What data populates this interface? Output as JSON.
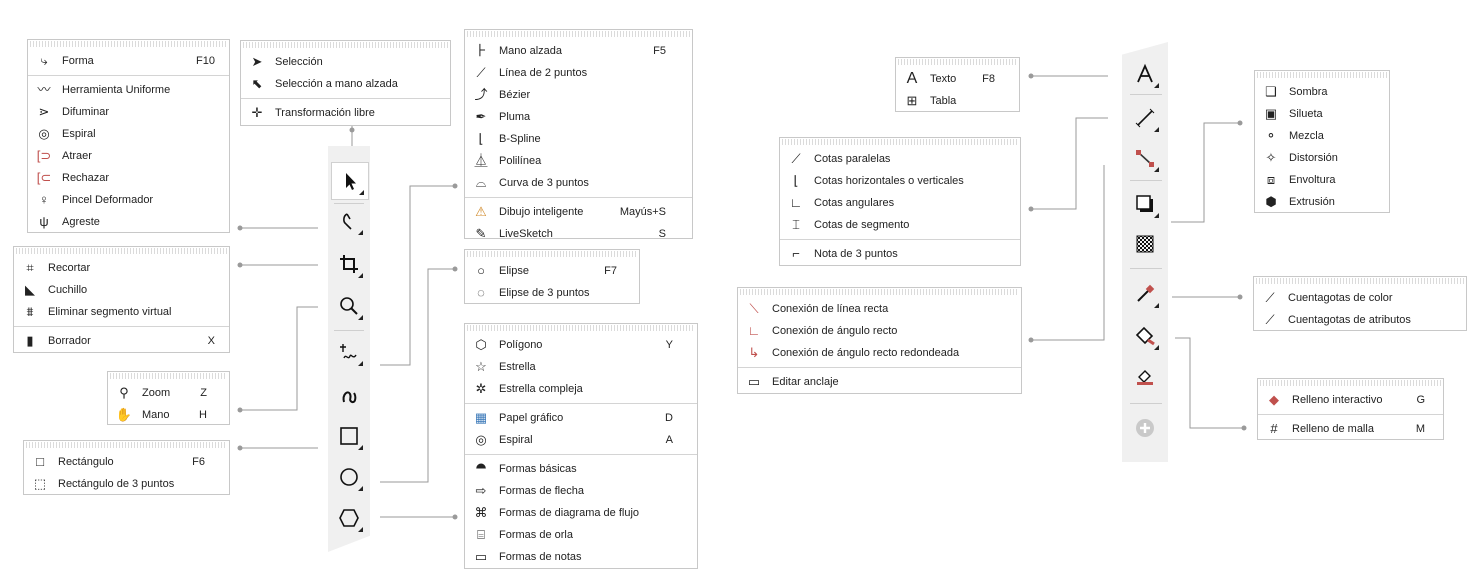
{
  "forma_menu": {
    "items": [
      {
        "label": "Forma",
        "shortcut": "F10",
        "icon": "shape-tool-icon"
      },
      {
        "label": "Herramienta Uniforme",
        "shortcut": "",
        "icon": "smooth-icon"
      },
      {
        "label": "Difuminar",
        "shortcut": "",
        "icon": "smear-icon"
      },
      {
        "label": "Espiral",
        "shortcut": "",
        "icon": "twirl-icon"
      },
      {
        "label": "Atraer",
        "shortcut": "",
        "icon": "attract-icon"
      },
      {
        "label": "Rechazar",
        "shortcut": "",
        "icon": "repel-icon"
      },
      {
        "label": "Pincel Deformador",
        "shortcut": "",
        "icon": "smudge-icon"
      },
      {
        "label": "Agreste",
        "shortcut": "",
        "icon": "roughen-icon"
      }
    ]
  },
  "seleccion_menu": {
    "items": [
      {
        "label": "Selección",
        "icon": "pick-arrow-icon"
      },
      {
        "label": "Selección a mano alzada",
        "icon": "freehand-pick-icon"
      },
      {
        "label": "Transformación libre",
        "icon": "free-transform-icon"
      }
    ]
  },
  "recortar_menu": {
    "items": [
      {
        "label": "Recortar",
        "shortcut": "",
        "icon": "crop-icon"
      },
      {
        "label": "Cuchillo",
        "shortcut": "",
        "icon": "knife-icon"
      },
      {
        "label": "Eliminar segmento virtual",
        "shortcut": "",
        "icon": "virtual-segment-delete-icon"
      },
      {
        "label": "Borrador",
        "shortcut": "X",
        "icon": "eraser-icon"
      }
    ]
  },
  "zoom_menu": {
    "items": [
      {
        "label": "Zoom",
        "shortcut": "Z",
        "icon": "zoom-icon"
      },
      {
        "label": "Mano",
        "shortcut": "H",
        "icon": "hand-icon"
      }
    ]
  },
  "rect_menu": {
    "items": [
      {
        "label": "Rectángulo",
        "shortcut": "F6",
        "icon": "rectangle-icon"
      },
      {
        "label": "Rectángulo de 3 puntos",
        "shortcut": "",
        "icon": "three-point-rectangle-icon"
      }
    ]
  },
  "curva_menu": {
    "items": [
      {
        "label": "Mano alzada",
        "shortcut": "F5",
        "icon": "freehand-icon"
      },
      {
        "label": "Línea de 2 puntos",
        "shortcut": "",
        "icon": "two-point-line-icon"
      },
      {
        "label": "Bézier",
        "shortcut": "",
        "icon": "bezier-icon"
      },
      {
        "label": "Pluma",
        "shortcut": "",
        "icon": "pen-icon"
      },
      {
        "label": "B-Spline",
        "shortcut": "",
        "icon": "bspline-icon"
      },
      {
        "label": "Polilínea",
        "shortcut": "",
        "icon": "polyline-icon"
      },
      {
        "label": "Curva de 3 puntos",
        "shortcut": "",
        "icon": "three-point-curve-icon"
      },
      {
        "label": "Dibujo inteligente",
        "shortcut": "Mayús+S",
        "icon": "smart-drawing-icon"
      },
      {
        "label": "LiveSketch",
        "shortcut": "S",
        "icon": "livesketch-icon"
      }
    ]
  },
  "elipse_menu": {
    "items": [
      {
        "label": "Elipse",
        "shortcut": "F7",
        "icon": "ellipse-icon"
      },
      {
        "label": "Elipse de 3 puntos",
        "shortcut": "",
        "icon": "three-point-ellipse-icon"
      }
    ]
  },
  "poligono_menu": {
    "items": [
      {
        "label": "Polígono",
        "shortcut": "Y",
        "icon": "polygon-icon"
      },
      {
        "label": "Estrella",
        "shortcut": "",
        "icon": "star-icon"
      },
      {
        "label": "Estrella compleja",
        "shortcut": "",
        "icon": "complex-star-icon"
      },
      {
        "label": "Papel gráfico",
        "shortcut": "D",
        "icon": "graph-paper-icon"
      },
      {
        "label": "Espiral",
        "shortcut": "A",
        "icon": "spiral-icon"
      },
      {
        "label": "Formas básicas",
        "shortcut": "",
        "icon": "basic-shapes-icon"
      },
      {
        "label": "Formas de flecha",
        "shortcut": "",
        "icon": "arrow-shapes-icon"
      },
      {
        "label": "Formas de diagrama de flujo",
        "shortcut": "",
        "icon": "flowchart-shapes-icon"
      },
      {
        "label": "Formas de orla",
        "shortcut": "",
        "icon": "banner-shapes-icon"
      },
      {
        "label": "Formas de notas",
        "shortcut": "",
        "icon": "callout-shapes-icon"
      }
    ]
  },
  "texto_menu": {
    "items": [
      {
        "label": "Texto",
        "shortcut": "F8",
        "icon": "text-icon"
      },
      {
        "label": "Tabla",
        "shortcut": "",
        "icon": "table-icon"
      }
    ]
  },
  "cotas_menu": {
    "items": [
      {
        "label": "Cotas paralelas",
        "icon": "parallel-dimension-icon"
      },
      {
        "label": "Cotas horizontales o verticales",
        "icon": "hv-dimension-icon"
      },
      {
        "label": "Cotas angulares",
        "icon": "angular-dimension-icon"
      },
      {
        "label": "Cotas de segmento",
        "icon": "segment-dimension-icon"
      },
      {
        "label": "Nota de 3 puntos",
        "icon": "three-point-callout-icon"
      }
    ]
  },
  "conexion_menu": {
    "items": [
      {
        "label": "Conexión de línea recta",
        "icon": "straight-connector-icon"
      },
      {
        "label": "Conexión de ángulo recto",
        "icon": "right-angle-connector-icon"
      },
      {
        "label": "Conexión de ángulo recto redondeada",
        "icon": "rounded-connector-icon"
      },
      {
        "label": "Editar anclaje",
        "icon": "edit-anchor-icon"
      }
    ]
  },
  "efectos_menu": {
    "items": [
      {
        "label": "Sombra",
        "icon": "drop-shadow-icon"
      },
      {
        "label": "Silueta",
        "icon": "contour-icon"
      },
      {
        "label": "Mezcla",
        "icon": "blend-icon"
      },
      {
        "label": "Distorsión",
        "icon": "distort-icon"
      },
      {
        "label": "Envoltura",
        "icon": "envelope-icon"
      },
      {
        "label": "Extrusión",
        "icon": "extrude-icon"
      }
    ]
  },
  "cuentagotas_menu": {
    "items": [
      {
        "label": "Cuentagotas de color",
        "icon": "color-eyedropper-icon"
      },
      {
        "label": "Cuentagotas de atributos",
        "icon": "attributes-eyedropper-icon"
      }
    ]
  },
  "relleno_menu": {
    "items": [
      {
        "label": "Relleno interactivo",
        "shortcut": "G",
        "icon": "interactive-fill-icon"
      },
      {
        "label": "Relleno de malla",
        "shortcut": "M",
        "icon": "mesh-fill-icon"
      }
    ]
  },
  "colors": {
    "toolbar": "#f0f0f0",
    "border": "#c8c8c8",
    "connector": "#999999"
  }
}
